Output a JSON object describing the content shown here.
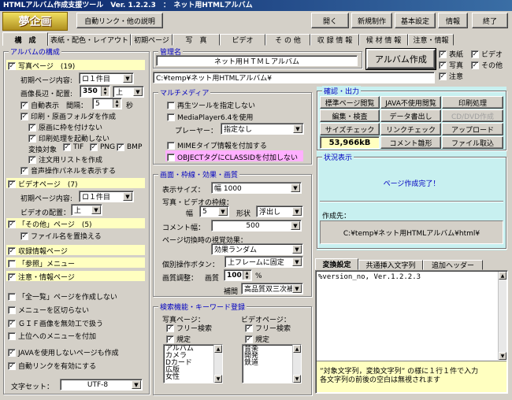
{
  "window": {
    "title": "HTMLアルバム作成支援ツール　Ver. 1.2.2.3　：　ネット用HTMLアルバム"
  },
  "logo": {
    "text": "夢企画"
  },
  "toolbar": {
    "auto_link": "自動リンク・他の説明",
    "open": "開く",
    "new": "新規制作",
    "settings": "基本設定",
    "info": "情報",
    "exit": "終了"
  },
  "tabs": [
    "構　成",
    "表紙・配色・レイアウト",
    "初期ページ",
    "写　真",
    "ビデオ",
    "そ の 他",
    "収 録 情 報",
    "候 材 情 報",
    "注意・情報"
  ],
  "album": {
    "group_title": "アルバムの構成",
    "photo_page": "写真ページ　(19)",
    "initial_content_label": "初期ページ内容:",
    "initial_content_value": "ロ１件目",
    "image_length_label": "画像長辺・配置:",
    "image_length_value": "350",
    "image_align_value": "上",
    "autoplay_label": "自動表示　間隔：",
    "autoplay_interval": "5",
    "autoplay_unit": "秒",
    "print_folder": "印刷・原画フォルダを作成",
    "no_frame": "原画に枠を付けない",
    "print_no_auto": "印刷処理を起動しない",
    "convert_label": "変換対象",
    "tif": "TIF",
    "png": "PNG",
    "bmp": "BMP",
    "order_list": "注文用リストを作成",
    "audio_panel": "音声操作パネルを表示する",
    "video_page": "ビデオページ　(7)",
    "video_initial_label": "初期ページ内容:",
    "video_initial_value": "ロ１件目",
    "video_align_label": "ビデオの配置：",
    "video_align_value": "上",
    "other_page": "「その他」ページ　(5)",
    "replace_filename": "ファイル名を置換える",
    "collection_page": "収録情報ページ",
    "reference_menu": "「参照」メニュー",
    "notice_page": "注意・情報ページ",
    "no_list_page": "「全一覧」ページを作成しない",
    "no_menu_divide": "メニューを区切らない",
    "gif_disabled": "ＧＩＦ画像を無効工で扱う",
    "upper_menu": "上位へのメニューを付加",
    "java_free": "JAVAを使用しないページも作成",
    "auto_link_enable": "自動リンクを有効にする",
    "charset_label": "文字セット：",
    "charset_value": "UTF-8"
  },
  "management": {
    "group_title": "管理名",
    "name_value": "ネット用ＨＴＭＬアルバム",
    "path_value": "C:¥temp¥ネット用HTMLアルバム¥",
    "create_button": "アルバム作成",
    "opt_cover": "表紙",
    "opt_video": "ビデオ",
    "opt_photo": "写真",
    "opt_other": "その他",
    "opt_notice": "注意"
  },
  "multimedia": {
    "group_title": "マルチメディア",
    "replay_tool": "再生ツールを指定しない",
    "mediaplayer": "MediaPlayer6.4を使用",
    "player_label": "プレーヤー：",
    "player_value": "指定なし",
    "mime_info": "MIMEタイプ情報を付加する",
    "object_classid": "OBJECTタグにCLASSIDを付加しない"
  },
  "screen": {
    "group_title": "画面・枠線・効果・画質",
    "display_size_label": "表示サイズ：",
    "display_size_value": "幅 1000",
    "frame_label": "写真・ビデオの枠線：",
    "width_label": "幅",
    "width_value": "5",
    "shape_label": "形状",
    "shape_value": "浮出し",
    "comment_width_label": "コメント幅：",
    "comment_width_value": "500",
    "transition_label": "ページ切換時の視覚効果：",
    "transition_value": "効果ランダム",
    "button_label": "個別操作ボタン：",
    "button_value": "上フレームに固定",
    "quality_label": "画質調整：",
    "quality_sub": "画質",
    "quality_value": "100",
    "quality_unit": "%",
    "interp_label": "補間",
    "interp_value": "高品質双三次補間"
  },
  "search": {
    "group_title": "検索機能・キーワード登録",
    "photo_label": "写真ページ：",
    "photo_free": "フリー検索",
    "photo_rule": "規定",
    "photo_keywords": [
      "アルバム",
      "カメラ",
      "Dカード",
      "広版",
      "女性"
    ],
    "video_label": "ビデオページ：",
    "video_free": "フリー検索",
    "video_rule": "規定",
    "video_keywords": [
      "音楽",
      "開発",
      "鉄道"
    ]
  },
  "check": {
    "group_title": "確認・出力",
    "b1": "標準ページ閲覧",
    "b2": "JAVA不使用閲覧",
    "b3": "印刷処理",
    "b4": "編集・検査",
    "b5": "データ書出し",
    "b6": "CD/DVD作成",
    "b7": "サイズチェック",
    "b8": "リンクチェック",
    "b9": "アップロード",
    "size_value": "53,966kB",
    "b10": "コメント雛形",
    "b11": "ファイル取込"
  },
  "status": {
    "group_title": "状況表示",
    "message": "ページ作成完了！",
    "dest_label": "作成先：",
    "dest_value": "C:¥temp¥ネット用HTMLアルバム¥html¥"
  },
  "bottom_tabs": [
    "変換設定",
    "共通挿入文字列",
    "追加ヘッダー"
  ],
  "convert": {
    "text": "%version_no, Ver.1.2.2.3",
    "note1": "”対象文字列，変換文字列” の様に１行１件で入力",
    "note2": "各文字列の前後の空白は無視されます"
  }
}
